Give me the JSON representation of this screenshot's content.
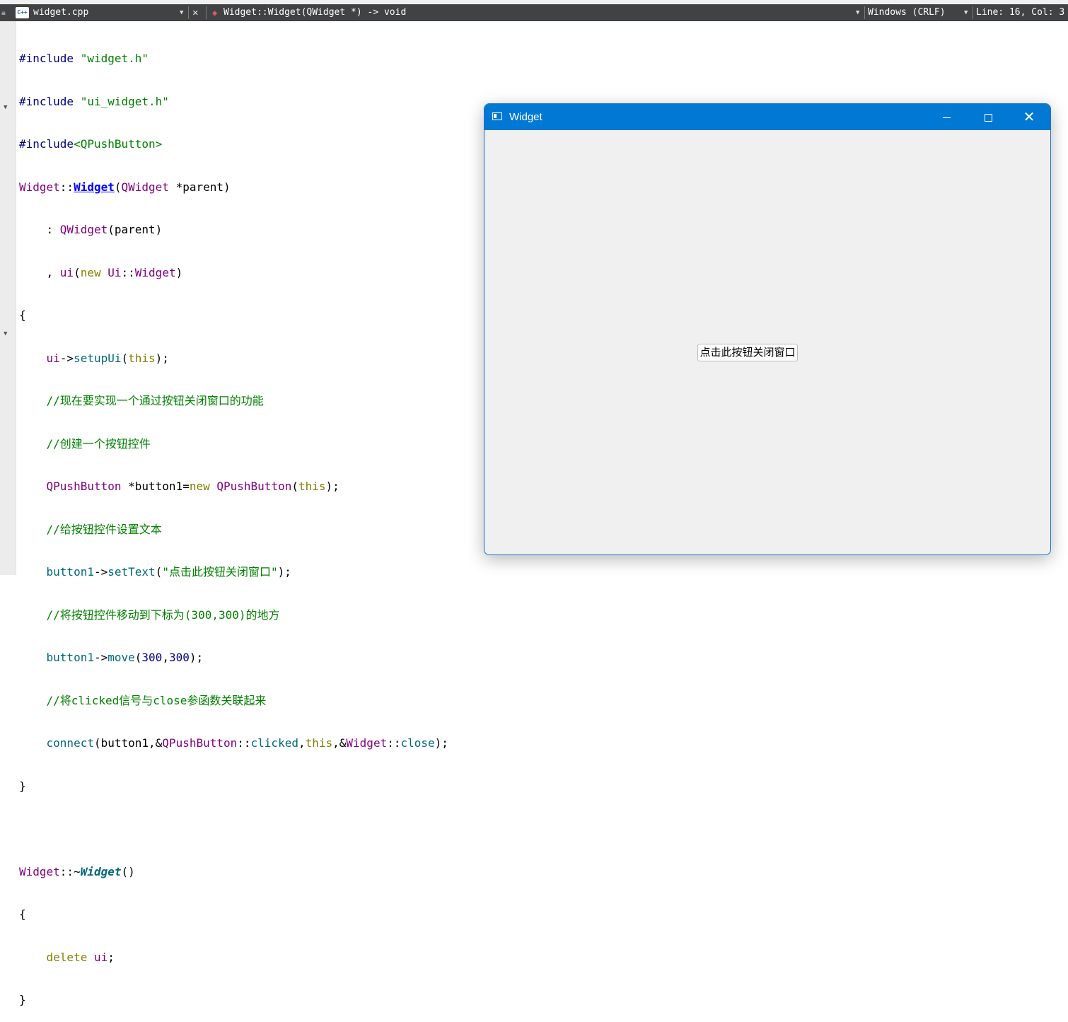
{
  "editor": {
    "file_icon": "C++",
    "filename": "widget.cpp",
    "function_signature": "Widget::Widget(QWidget *) -> void",
    "encoding": "Windows (CRLF)",
    "cursor_position": "Line: 16, Col: 3",
    "icons": {
      "lock": "lock-icon",
      "close": "close-icon",
      "symbol": "diamond-icon",
      "dropdown": "chevron-down-icon"
    }
  },
  "code": {
    "l1_dir": "#include",
    "l1_str": "\"widget.h\"",
    "l2_dir": "#include",
    "l2_str": "\"ui_widget.h\"",
    "l3_dir": "#include",
    "l3_str": "<QPushButton>",
    "l4_cls": "Widget",
    "l4_op": "::",
    "l4_fn": "Widget",
    "l4_open": "(",
    "l4_ty": "QWidget",
    "l4_rest": " *parent)",
    "l5_pre": "    : ",
    "l5_ty": "QWidget",
    "l5_rest": "(parent)",
    "l6_pre": "    , ",
    "l6_mem": "ui",
    "l6_open": "(",
    "l6_kw": "new",
    "l6_sp": " ",
    "l6_ns": "Ui",
    "l6_op": "::",
    "l6_ty": "Widget",
    "l6_close": ")",
    "l7": "{",
    "l8_pre": "    ",
    "l8_mem": "ui",
    "l8_arrow": "->",
    "l8_fn": "setupUi",
    "l8_open": "(",
    "l8_kw": "this",
    "l8_close": ");",
    "l9": "    //现在要实现一个通过按钮关闭窗口的功能",
    "l10": "    //创建一个按钮控件",
    "l11_pre": "    ",
    "l11_ty": "QPushButton",
    "l11_mid": " *button1=",
    "l11_kw": "new",
    "l11_sp": " ",
    "l11_ty2": "QPushButton",
    "l11_open": "(",
    "l11_kw2": "this",
    "l11_close": ");",
    "l12": "    //给按钮控件设置文本",
    "l13_pre": "    ",
    "l13_var": "button1",
    "l13_arrow": "->",
    "l13_fn": "setText",
    "l13_open": "(",
    "l13_str": "\"点击此按钮关闭窗口\"",
    "l13_close": ");",
    "l14": "    //将按钮控件移动到下标为(300,300)的地方",
    "l15_pre": "    ",
    "l15_var": "button1",
    "l15_arrow": "->",
    "l15_fn": "move",
    "l15_open": "(",
    "l15_n1": "300",
    "l15_comma": ",",
    "l15_n2": "300",
    "l15_close": ");",
    "l16": "    //将clicked信号与close参函数关联起来",
    "l17_pre": "    ",
    "l17_fn": "connect",
    "l17_a": "(button1,&",
    "l17_ty": "QPushButton",
    "l17_op": "::",
    "l17_fn2": "clicked",
    "l17_comma": ",",
    "l17_kw": "this",
    "l17_amp": ",&",
    "l17_ty2": "Widget",
    "l17_op2": "::",
    "l17_fn3": "close",
    "l17_close": ");",
    "l18": "}",
    "l19": "",
    "l20_cls": "Widget",
    "l20_op": "::~",
    "l20_fn": "Widget",
    "l20_rest": "()",
    "l21": "{",
    "l22_pre": "    ",
    "l22_kw": "delete",
    "l22_sp": " ",
    "l22_mem": "ui",
    "l22_end": ";",
    "l23": "}"
  },
  "qt_window": {
    "title": "Widget",
    "close_glyph": "✕",
    "button_label": "点击此按钮关闭窗口",
    "title_bar_color": "#0078d4",
    "icons": {
      "app": "window-app-icon",
      "minimize": "minimize-icon",
      "maximize": "maximize-icon",
      "close": "close-icon"
    }
  }
}
